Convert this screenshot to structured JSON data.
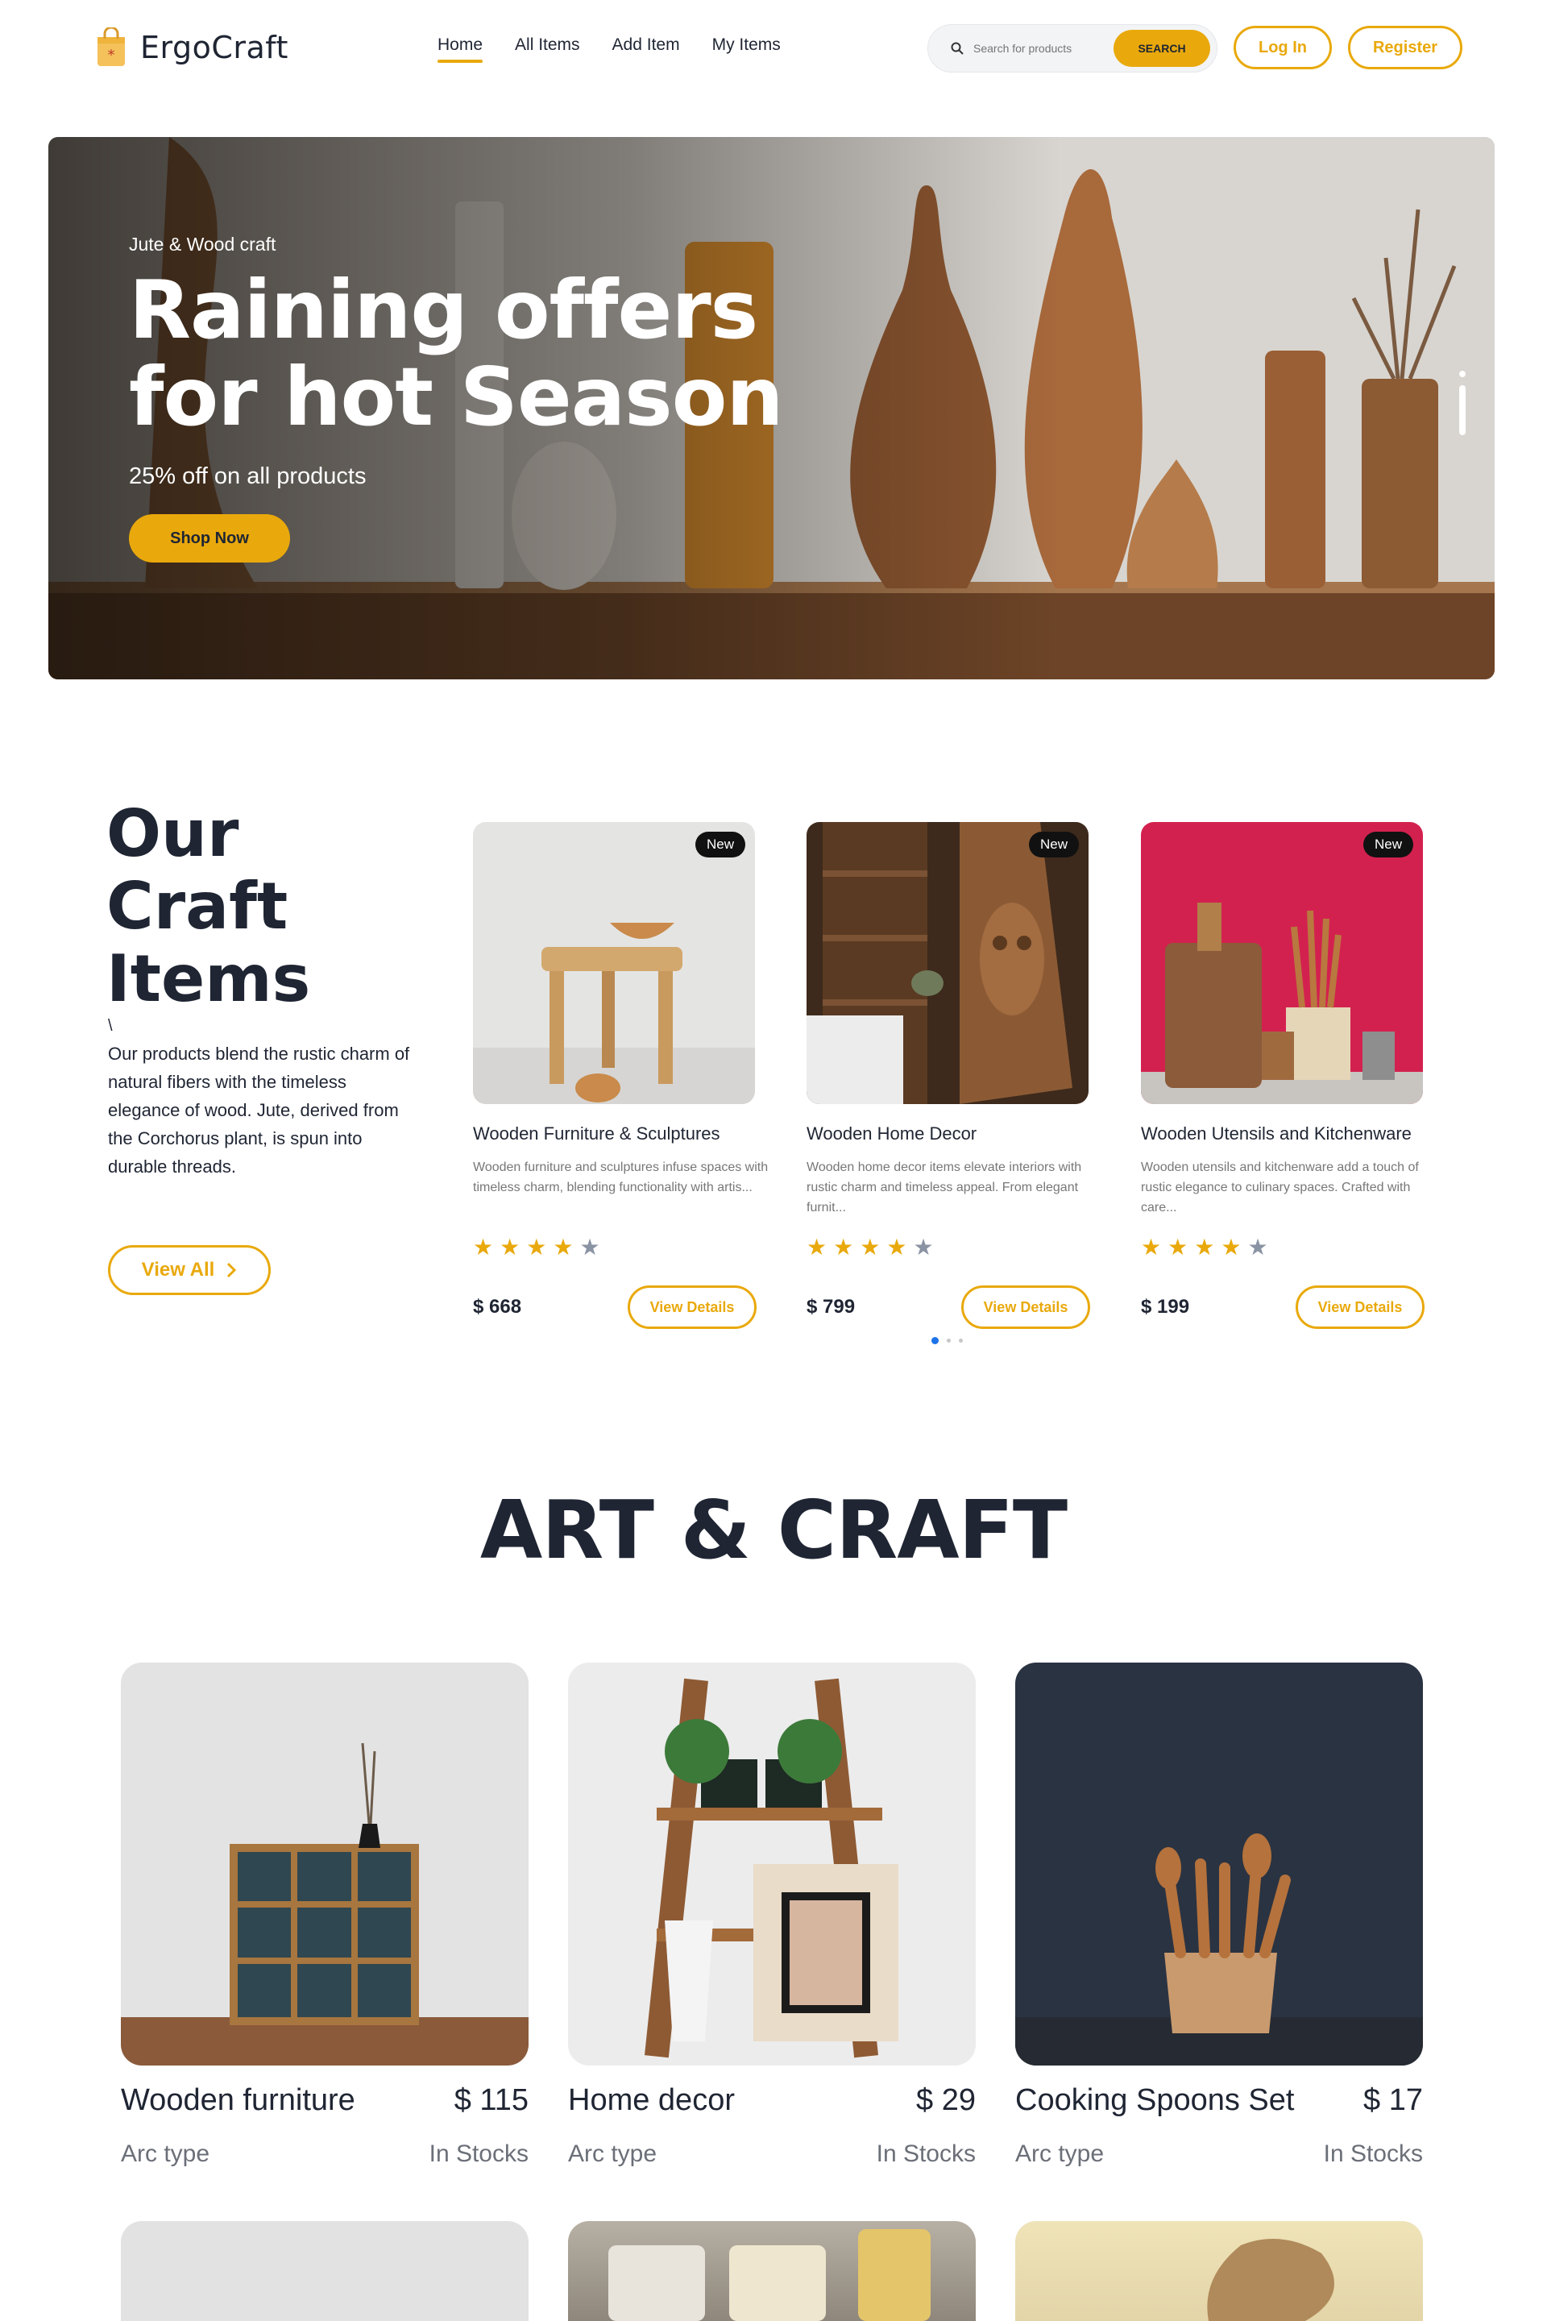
{
  "brand": {
    "name": "ErgoCraft"
  },
  "nav": {
    "items": [
      {
        "label": "Home",
        "active": true
      },
      {
        "label": "All Items"
      },
      {
        "label": "Add Item"
      },
      {
        "label": "My Items"
      }
    ],
    "search_placeholder": "Search for products",
    "search_button": "SEARCH",
    "login": "Log In",
    "register": "Register"
  },
  "hero": {
    "kicker": "Jute & Wood craft",
    "title_line1": "Raining offers",
    "title_line2": "for hot Season",
    "subtitle": "25% off on all products",
    "cta": "Shop Now"
  },
  "craft": {
    "heading_line1": "Our",
    "heading_line2": "Craft",
    "heading_line3": "Items",
    "slash": "\\",
    "description": "Our products blend the rustic charm of natural fibers with the timeless elegance of wood. Jute, derived from the Corchorus plant, is spun into durable threads.",
    "view_all": "View All",
    "cards": [
      {
        "badge": "New",
        "title": "Wooden Furniture & Sculptures",
        "desc": "Wooden furniture and sculptures infuse spaces with timeless charm, blending functionality with artis...",
        "rating": 4,
        "price": "$ 668",
        "button": "View Details"
      },
      {
        "badge": "New",
        "title": "Wooden Home Decor",
        "desc": "Wooden home decor items elevate interiors with rustic charm and timeless appeal. From elegant furnit...",
        "rating": 4,
        "price": "$ 799",
        "button": "View Details"
      },
      {
        "badge": "New",
        "title": "Wooden Utensils and Kitchenware",
        "desc": "Wooden utensils and kitchenware add a touch of rustic elegance to culinary spaces. Crafted with care...",
        "rating": 4,
        "price": "$ 199",
        "button": "View Details"
      }
    ]
  },
  "art": {
    "heading": "ART & CRAFT",
    "products": [
      {
        "name": "Wooden furniture",
        "price": "$ 115",
        "type": "Arc type",
        "stock": "In Stocks"
      },
      {
        "name": "Home decor",
        "price": "$ 29",
        "type": "Arc type",
        "stock": "In Stocks"
      },
      {
        "name": "Cooking Spoons Set",
        "price": "$ 17",
        "type": "Arc type",
        "stock": "In Stocks"
      }
    ]
  },
  "colors": {
    "accent": "#e9a90c",
    "text": "#1f2533",
    "pager_active": "#1e73e8"
  }
}
